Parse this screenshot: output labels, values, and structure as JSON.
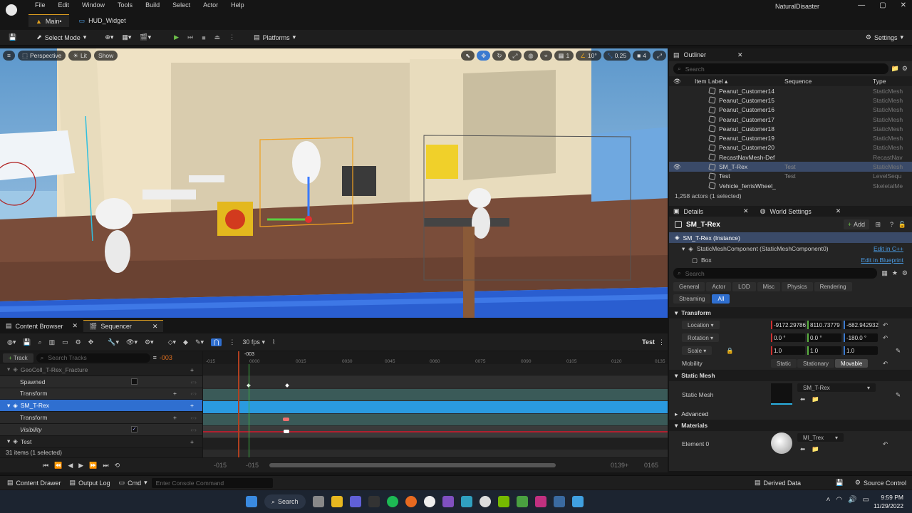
{
  "menu": [
    "File",
    "Edit",
    "Window",
    "Tools",
    "Build",
    "Select",
    "Actor",
    "Help"
  ],
  "tabs": {
    "main": "Main•",
    "hud": "HUD_Widget"
  },
  "app_title": "NaturalDisaster",
  "toolbar": {
    "select_mode": "Select Mode",
    "platforms": "Platforms",
    "settings": "Settings"
  },
  "viewport": {
    "perspective": "Perspective",
    "lit": "Lit",
    "show": "Show",
    "grid_snap": "1",
    "angle_snap": "10°",
    "scale_snap": "0.25",
    "cam_speed": "4"
  },
  "outliner": {
    "title": "Outliner",
    "search_placeholder": "Search",
    "col_label": "Item Label ▴",
    "col_seq": "Sequence",
    "col_type": "Type",
    "rows": [
      {
        "name": "Peanut_Customer14",
        "seq": "",
        "type": "StaticMesh"
      },
      {
        "name": "Peanut_Customer15",
        "seq": "",
        "type": "StaticMesh"
      },
      {
        "name": "Peanut_Customer16",
        "seq": "",
        "type": "StaticMesh"
      },
      {
        "name": "Peanut_Customer17",
        "seq": "",
        "type": "StaticMesh"
      },
      {
        "name": "Peanut_Customer18",
        "seq": "",
        "type": "StaticMesh"
      },
      {
        "name": "Peanut_Customer19",
        "seq": "",
        "type": "StaticMesh"
      },
      {
        "name": "Peanut_Customer20",
        "seq": "",
        "type": "StaticMesh"
      },
      {
        "name": "RecastNavMesh-Def",
        "seq": "",
        "type": "RecastNav"
      },
      {
        "name": "SM_T-Rex",
        "seq": "Test",
        "type": "StaticMesh"
      },
      {
        "name": "Test",
        "seq": "Test",
        "type": "LevelSequ"
      },
      {
        "name": "Vehicle_ferrisWheel_",
        "seq": "",
        "type": "SkeletalMe"
      }
    ],
    "count": "1,258 actors (1 selected)"
  },
  "details": {
    "tab": "Details",
    "world_settings": "World Settings",
    "actor": "SM_T-Rex",
    "add": "Add",
    "instance": "SM_T-Rex (Instance)",
    "component": "StaticMeshComponent (StaticMeshComponent0)",
    "edit_cpp": "Edit in C++",
    "box": "Box",
    "edit_bp": "Edit in Blueprint",
    "search_placeholder": "Search",
    "cats": [
      "General",
      "Actor",
      "LOD",
      "Misc",
      "Physics",
      "Rendering"
    ],
    "cats2": [
      "Streaming",
      "All"
    ],
    "transform": "Transform",
    "location": "Location",
    "rotation": "Rotation",
    "scale": "Scale",
    "loc": [
      "-9172.29786",
      "8110.73779",
      "-682.942932"
    ],
    "rot": [
      "0.0 °",
      "0.0 °",
      "-180.0 °"
    ],
    "scl": [
      "1.0",
      "1.0",
      "1.0"
    ],
    "mobility": "Mobility",
    "mob_opts": [
      "Static",
      "Stationary",
      "Movable"
    ],
    "static_mesh_sect": "Static Mesh",
    "static_mesh": "Static Mesh",
    "mesh_value": "SM_T-Rex",
    "advanced": "Advanced",
    "materials": "Materials",
    "element0": "Element 0",
    "mat_value": "MI_Trex"
  },
  "bottom_tabs": {
    "content_browser": "Content Browser",
    "sequencer": "Sequencer"
  },
  "sequencer": {
    "fps": "30 fps",
    "seq_name": "Test",
    "track": "Track",
    "search_placeholder": "Search Tracks",
    "frame": "-003",
    "ticks": [
      "-015",
      "0000",
      "0015",
      "0030",
      "0045",
      "0060",
      "0075",
      "0090",
      "0105",
      "0120",
      "0135"
    ],
    "playhead": "-003",
    "tracks": [
      {
        "label": "GeoColl_T-Rex_Fracture",
        "indent": 1
      },
      {
        "label": "Spawned",
        "indent": 2
      },
      {
        "label": "Transform",
        "indent": 2
      },
      {
        "label": "SM_T-Rex",
        "indent": 1
      },
      {
        "label": "Transform",
        "indent": 2
      },
      {
        "label": "Visibility",
        "indent": 2
      },
      {
        "label": "Test",
        "indent": 1
      }
    ],
    "items": "31 items (1 selected)",
    "range_start": "-015",
    "range_start2": "-015",
    "range_end": "0139+",
    "range_end2": "0165"
  },
  "status": {
    "content_drawer": "Content Drawer",
    "output_log": "Output Log",
    "cmd": "Cmd",
    "console_placeholder": "Enter Console Command",
    "derived": "Derived Data",
    "source": "Source Control"
  },
  "taskbar": {
    "search": "Search",
    "time": "9:59 PM",
    "date": "11/29/2022"
  }
}
